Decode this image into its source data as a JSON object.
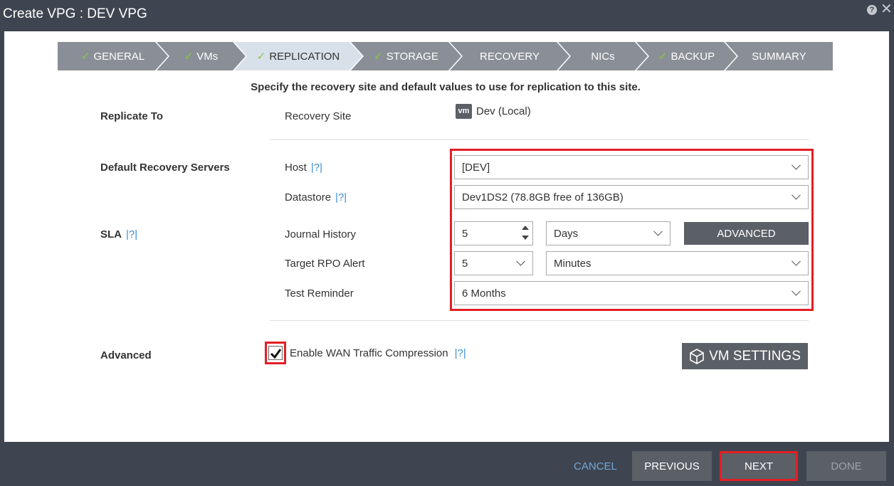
{
  "window": {
    "title": "Create VPG : DEV VPG",
    "help_glyph": "?",
    "close_glyph": "✕"
  },
  "wizard": {
    "steps": [
      {
        "label": "GENERAL",
        "checked": true
      },
      {
        "label": "VMs",
        "checked": true
      },
      {
        "label": "REPLICATION",
        "checked": true,
        "active": true
      },
      {
        "label": "STORAGE",
        "checked": true
      },
      {
        "label": "RECOVERY",
        "checked": false
      },
      {
        "label": "NICs",
        "checked": false
      },
      {
        "label": "BACKUP",
        "checked": true
      },
      {
        "label": "SUMMARY",
        "checked": false
      }
    ]
  },
  "subtitle": "Specify the recovery site and default values to use for replication to this site.",
  "sections": {
    "replicate_to": "Replicate To",
    "default_recovery_servers": "Default Recovery Servers",
    "sla": "SLA",
    "advanced": "Advanced"
  },
  "help_link": "|?|",
  "recovery_site": {
    "label": "Recovery Site",
    "logo_text": "vm",
    "value": "Dev (Local)"
  },
  "host": {
    "label": "Host",
    "value": "[DEV]"
  },
  "datastore": {
    "label": "Datastore",
    "value": "Dev1DS2 (78.8GB free of 136GB)"
  },
  "journal_history": {
    "label": "Journal History",
    "value": "5",
    "unit": "Days",
    "advanced_button": "ADVANCED"
  },
  "target_rpo": {
    "label": "Target RPO Alert",
    "value": "5",
    "unit": "Minutes"
  },
  "test_reminder": {
    "label": "Test Reminder",
    "value": "6 Months"
  },
  "wan": {
    "label": "Enable WAN Traffic Compression",
    "checked": true
  },
  "vm_settings_button": "VM SETTINGS",
  "footer": {
    "cancel": "CANCEL",
    "previous": "PREVIOUS",
    "next": "NEXT",
    "done": "DONE"
  },
  "colors": {
    "highlight": "#e31e24",
    "check": "#8dc63f",
    "link": "#3d8fd1",
    "chrome": "#3f4550"
  }
}
